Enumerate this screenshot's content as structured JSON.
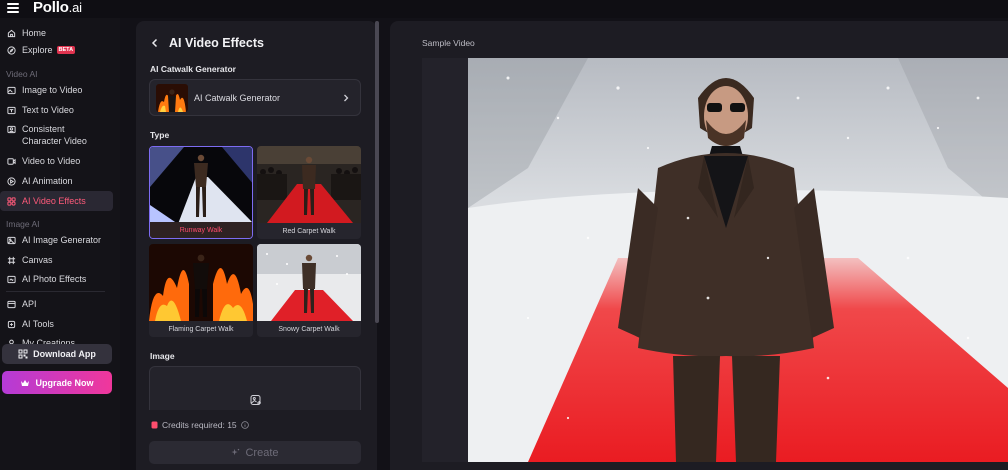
{
  "app": {
    "logo_main": "Pollo",
    "logo_suffix": ".ai"
  },
  "sidebar": {
    "home": "Home",
    "explore": "Explore",
    "explore_badge": "BETA",
    "section_video": "Video AI",
    "image_to_video": "Image to Video",
    "text_to_video": "Text to Video",
    "consistent_character": "Consistent Character Video",
    "video_to_video": "Video to Video",
    "ai_animation": "AI Animation",
    "ai_video_effects": "AI Video Effects",
    "section_image": "Image AI",
    "ai_image_generator": "AI Image Generator",
    "canvas": "Canvas",
    "ai_photo_effects": "AI Photo Effects",
    "api": "API",
    "ai_tools": "AI Tools",
    "my_creations": "My Creations",
    "download_app": "Download App",
    "upgrade_now": "Upgrade Now"
  },
  "panel": {
    "title": "AI Video Effects",
    "generator_section": "AI Catwalk Generator",
    "generator_selected": "AI Catwalk Generator",
    "type_section": "Type",
    "types": [
      {
        "label": "Runway Walk",
        "selected": true
      },
      {
        "label": "Red Carpet Walk",
        "selected": false
      },
      {
        "label": "Flaming Carpet Walk",
        "selected": false
      },
      {
        "label": "Snowy Carpet Walk",
        "selected": false
      }
    ],
    "image_section": "Image",
    "credits_text": "Credits required: 15",
    "create_button": "Create"
  },
  "preview": {
    "label": "Sample Video"
  },
  "colors": {
    "accent": "#ff4d6d",
    "selected_border": "#7d6cf2",
    "upgrade_from": "#b43bd6",
    "upgrade_to": "#f0379b"
  }
}
